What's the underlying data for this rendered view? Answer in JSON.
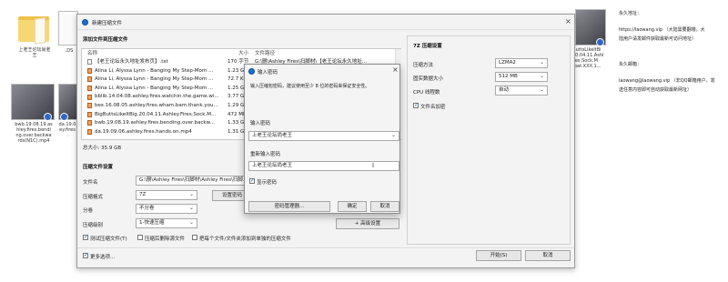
{
  "desktop": {
    "icons": [
      {
        "label": "上老王论坛尚老\n王"
      },
      {
        "label": ".DS"
      },
      {
        "label": "bwb.19.08.19.as\nhley.fires.bendi\nng.over.backwa\nrds(N1C).mp4"
      },
      {
        "label": "da.19.0\ney.fires\n."
      },
      {
        "label": "gButtsLikeItBi\nl.20.04.11.Ashl\nFires.Sock.M\nmbat.XXX.1..."
      }
    ],
    "notes": {
      "permanent_addr_title": "永久地址：",
      "permanent_addr_body": "https://laowang.vip （大陆需要翻墙，大\n陆用户请发邮件获取最新可访问地址）",
      "email_title": "永久邮箱：",
      "email_body": "laowang@laowang.vip （非QQ邮箱用户，发\n送任意内容即可自动获取最新网址）"
    }
  },
  "main_dialog": {
    "title": "新建压缩文件",
    "add_files_title": "添加文件到压缩文件",
    "columns": {
      "name": "名称",
      "size": "大小",
      "path": "文件路径"
    },
    "files": [
      {
        "name": "【老王论坛永久地址发布页】.txt",
        "size": "170 字节",
        "path": "G:\\删\\Ashley Fires\\扫脚材\\【老王论坛永久地址...",
        "icon": "txt"
      },
      {
        "name": "Alina Li, Alyssa Lynn - Banging My Step-Mom ...",
        "size": "1.23 GB",
        "path": "G:\\删\\Ashley Fires...",
        "icon": "video"
      },
      {
        "name": "Alina Li, Alyssa Lynn - Banging My Step-Mom ...",
        "size": "72.7 KB",
        "path": "G:\\删\\Ashley Fires...",
        "icon": "video"
      },
      {
        "name": "Alina Li, Alyssa Lynn - Banging My Step-Mom ...",
        "size": "1.25 GB",
        "path": "G:\\删\\Ashley Fires...",
        "icon": "video"
      },
      {
        "name": "bblib.14.04.08.ashley.fires.watchin.the.game.wi...",
        "size": "3.77 GB",
        "path": "G:\\删\\Ashley Fires...",
        "icon": "video"
      },
      {
        "name": "bex.16.08.05.ashley.fires.wham.bam.thank.you...",
        "size": "1.29 GB",
        "path": "G:\\删\\Ashley Fires...",
        "icon": "video"
      },
      {
        "name": "BigButtsLikeItBig.20.04.11.Ashley.Fires.Sock.M...",
        "size": "472 MB",
        "path": "G:\\删\\Ashley Fires...",
        "icon": "video"
      },
      {
        "name": "bwb.19.08.19.ashley.fires.bending.over.backw...",
        "size": "1.33 GB",
        "path": "G:\\删\\Ashley Fires...",
        "icon": "video"
      },
      {
        "name": "da.19.09.06.ashley.fires.hands.on.mp4",
        "size": "1.31 GB",
        "path": "G:\\删\\Ashley Fires...",
        "icon": "video"
      }
    ],
    "total_size": "总大小: 35.9 GB",
    "settings_title": "压缩文件设置",
    "file_name_label": "文件名",
    "file_name_value": "G:\\删\\Ashley Fires\\扫脚材\\Ashley Fires\\扫脚...",
    "format_label": "压缩格式",
    "format_value": "7Z",
    "set_password_button": "设置密码",
    "split_label": "分卷",
    "split_value": "不分卷",
    "level_label": "压缩级别",
    "level_value": "1-快速压缩",
    "advanced_button": "+ 高级设置",
    "check_test": "测试压缩文件(T)",
    "check_delete": "压缩后删除源文件",
    "check_separate": "把每个文件/文件夹添加到单独的压缩文件",
    "more_options": "更多选项...",
    "start_button": "开始(S)",
    "cancel_button": "取消",
    "right_panel": {
      "title": "7Z 压缩设置",
      "method_label": "压缩方法",
      "method_value": "LZMA2",
      "dict_label": "固实数据大小",
      "dict_value": "512 MB",
      "threads_label": "CPU 线程数",
      "threads_value": "自动",
      "encrypt_names": "文件名加密"
    }
  },
  "password_dialog": {
    "title": "输入密码",
    "hint": "输入压缩包密码，建议使用至少 8 位的密码来保证安全性。",
    "password_label": "输入密码",
    "password_value": "上老王论坛尚老王",
    "confirm_label": "重新输入密码",
    "confirm_value": "上老王论坛尚老王",
    "show_password": "显示密码",
    "manager_button": "密码管理器...",
    "ok_button": "确定",
    "cancel_button": "取消"
  }
}
